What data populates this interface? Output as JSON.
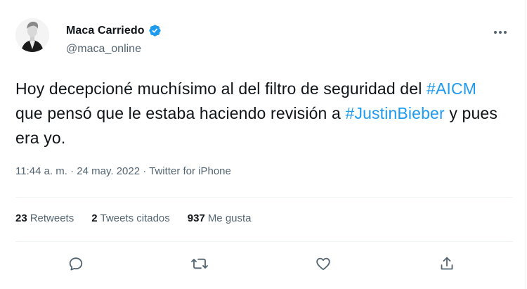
{
  "author": {
    "display_name": "Maca Carriedo",
    "handle": "@maca_online",
    "avatar_icon": "profile-photo",
    "verified_icon": "verified-badge-icon"
  },
  "tweet": {
    "text_part1": "Hoy decepcioné muchísimo al del filtro de seguridad del ",
    "hashtag1": "#AICM",
    "text_part2": " que pensó que le estaba haciendo revisión a ",
    "hashtag2": "#JustinBieber",
    "text_part3": " y pues era yo."
  },
  "meta": {
    "time": "11:44 a. m.",
    "separator": "·",
    "date": "24 may. 2022",
    "source": "Twitter for iPhone"
  },
  "stats": {
    "retweets_count": "23",
    "retweets_label": "Retweets",
    "quotes_count": "2",
    "quotes_label": "Tweets citados",
    "likes_count": "937",
    "likes_label": "Me gusta"
  },
  "actions": [
    "reply-icon",
    "retweet-icon",
    "like-icon",
    "share-icon"
  ],
  "colors": {
    "accent": "#1d9bf0",
    "secondary_text": "#536471",
    "primary_text": "#0f1419",
    "divider": "#eff3f4"
  }
}
